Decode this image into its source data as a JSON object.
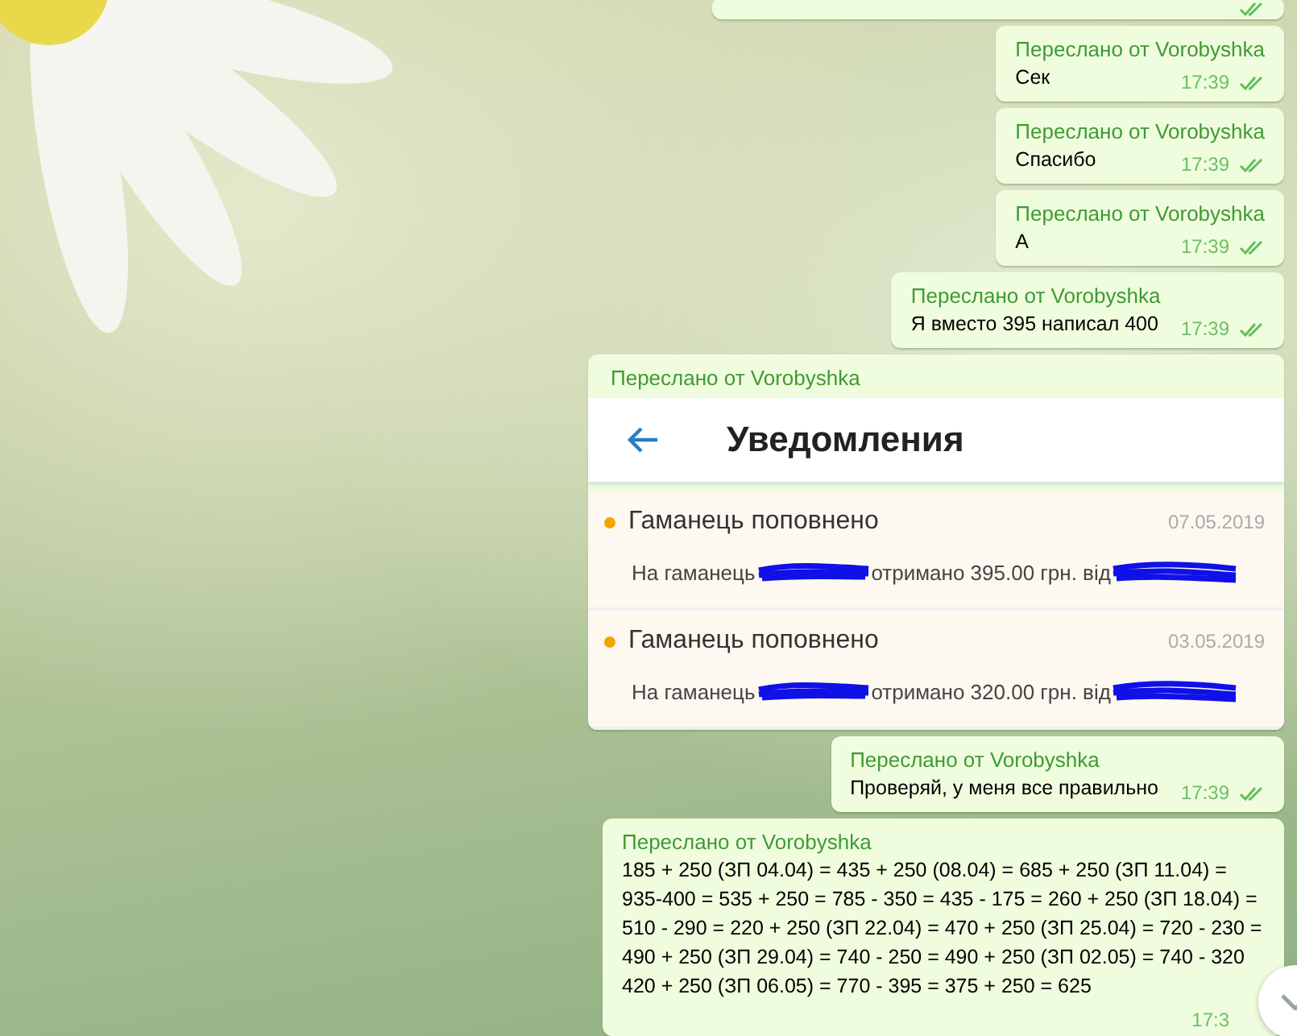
{
  "messages": [
    {
      "kind": "cut",
      "read": true
    },
    {
      "kind": "text",
      "forwarded_from": "Переслано от Vorobyshka",
      "text": "Сек",
      "time": "17:39",
      "read": true
    },
    {
      "kind": "text",
      "forwarded_from": "Переслано от Vorobyshka",
      "text": "Спасибо",
      "time": "17:39",
      "read": true
    },
    {
      "kind": "text",
      "forwarded_from": "Переслано от Vorobyshka",
      "text": "А",
      "time": "17:39",
      "read": true
    },
    {
      "kind": "text",
      "forwarded_from": "Переслано от Vorobyshka",
      "text": "Я вместо 395 написал 400",
      "time": "17:39",
      "read": true
    },
    {
      "kind": "screenshot",
      "forwarded_from": "Переслано от Vorobyshka",
      "screenshot": {
        "title": "Уведомления",
        "notifications": [
          {
            "title": "Гаманець поповнено",
            "date": "07.05.2019",
            "body_start": "На гаманець",
            "body_end": "отримано 395.00 грн. від",
            "unread": true
          },
          {
            "title": "Гаманець поповнено",
            "date": "03.05.2019",
            "body_start": "На гаманець",
            "body_end": "отримано 320.00 грн. від",
            "unread": true
          }
        ]
      }
    },
    {
      "kind": "text",
      "forwarded_from": "Переслано от Vorobyshka",
      "text": "Проверяй, у меня все правильно",
      "time": "17:39",
      "read": true
    },
    {
      "kind": "text",
      "forwarded_from": "Переслано от Vorobyshka",
      "text": "185 + 250 (ЗП 04.04) = 435 + 250 (08.04) = 685 + 250 (ЗП 11.04) = 935-400 = 535 + 250 = 785 - 350 = 435 - 175 = 260 + 250 (ЗП 18.04) = 510 - 290 = 220 + 250 (ЗП 22.04) = 470 + 250 (ЗП 25.04) = 720 - 230 = 490 + 250 (ЗП 29.04) = 740 - 250 = 490 + 250 (ЗП 02.05) = 740 - 320 420 + 250 (ЗП 06.05) = 770 - 395 = 375 + 250 = 625",
      "time": "17:3"
    }
  ]
}
